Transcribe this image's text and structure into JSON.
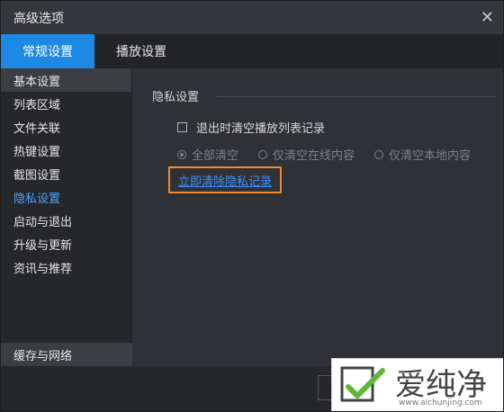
{
  "window": {
    "title": "高级选项"
  },
  "tabs": [
    {
      "label": "常规设置",
      "active": true
    },
    {
      "label": "播放设置",
      "active": false
    }
  ],
  "sidebar": {
    "items": [
      {
        "label": "基本设置"
      },
      {
        "label": "列表区域"
      },
      {
        "label": "文件关联"
      },
      {
        "label": "热键设置"
      },
      {
        "label": "截图设置"
      },
      {
        "label": "隐私设置"
      },
      {
        "label": "启动与退出"
      },
      {
        "label": "升级与更新"
      },
      {
        "label": "资讯与推荐"
      }
    ],
    "bottom_item": {
      "label": "缓存与网络"
    }
  },
  "privacy": {
    "section_title": "隐私设置",
    "checkbox_label": "退出时清空播放列表记录",
    "radios": [
      {
        "label": "全部清空",
        "checked": true
      },
      {
        "label": "仅清空在线内容",
        "checked": false
      },
      {
        "label": "仅清空本地内容",
        "checked": false
      }
    ],
    "clear_link": "立即清除隐私记录"
  },
  "watermark": {
    "brand": "爱纯净",
    "url": "www.aichunjing.com"
  },
  "colors": {
    "accent": "#1e88e5",
    "link": "#3d92ff",
    "highlight_border": "#f08a2c"
  }
}
